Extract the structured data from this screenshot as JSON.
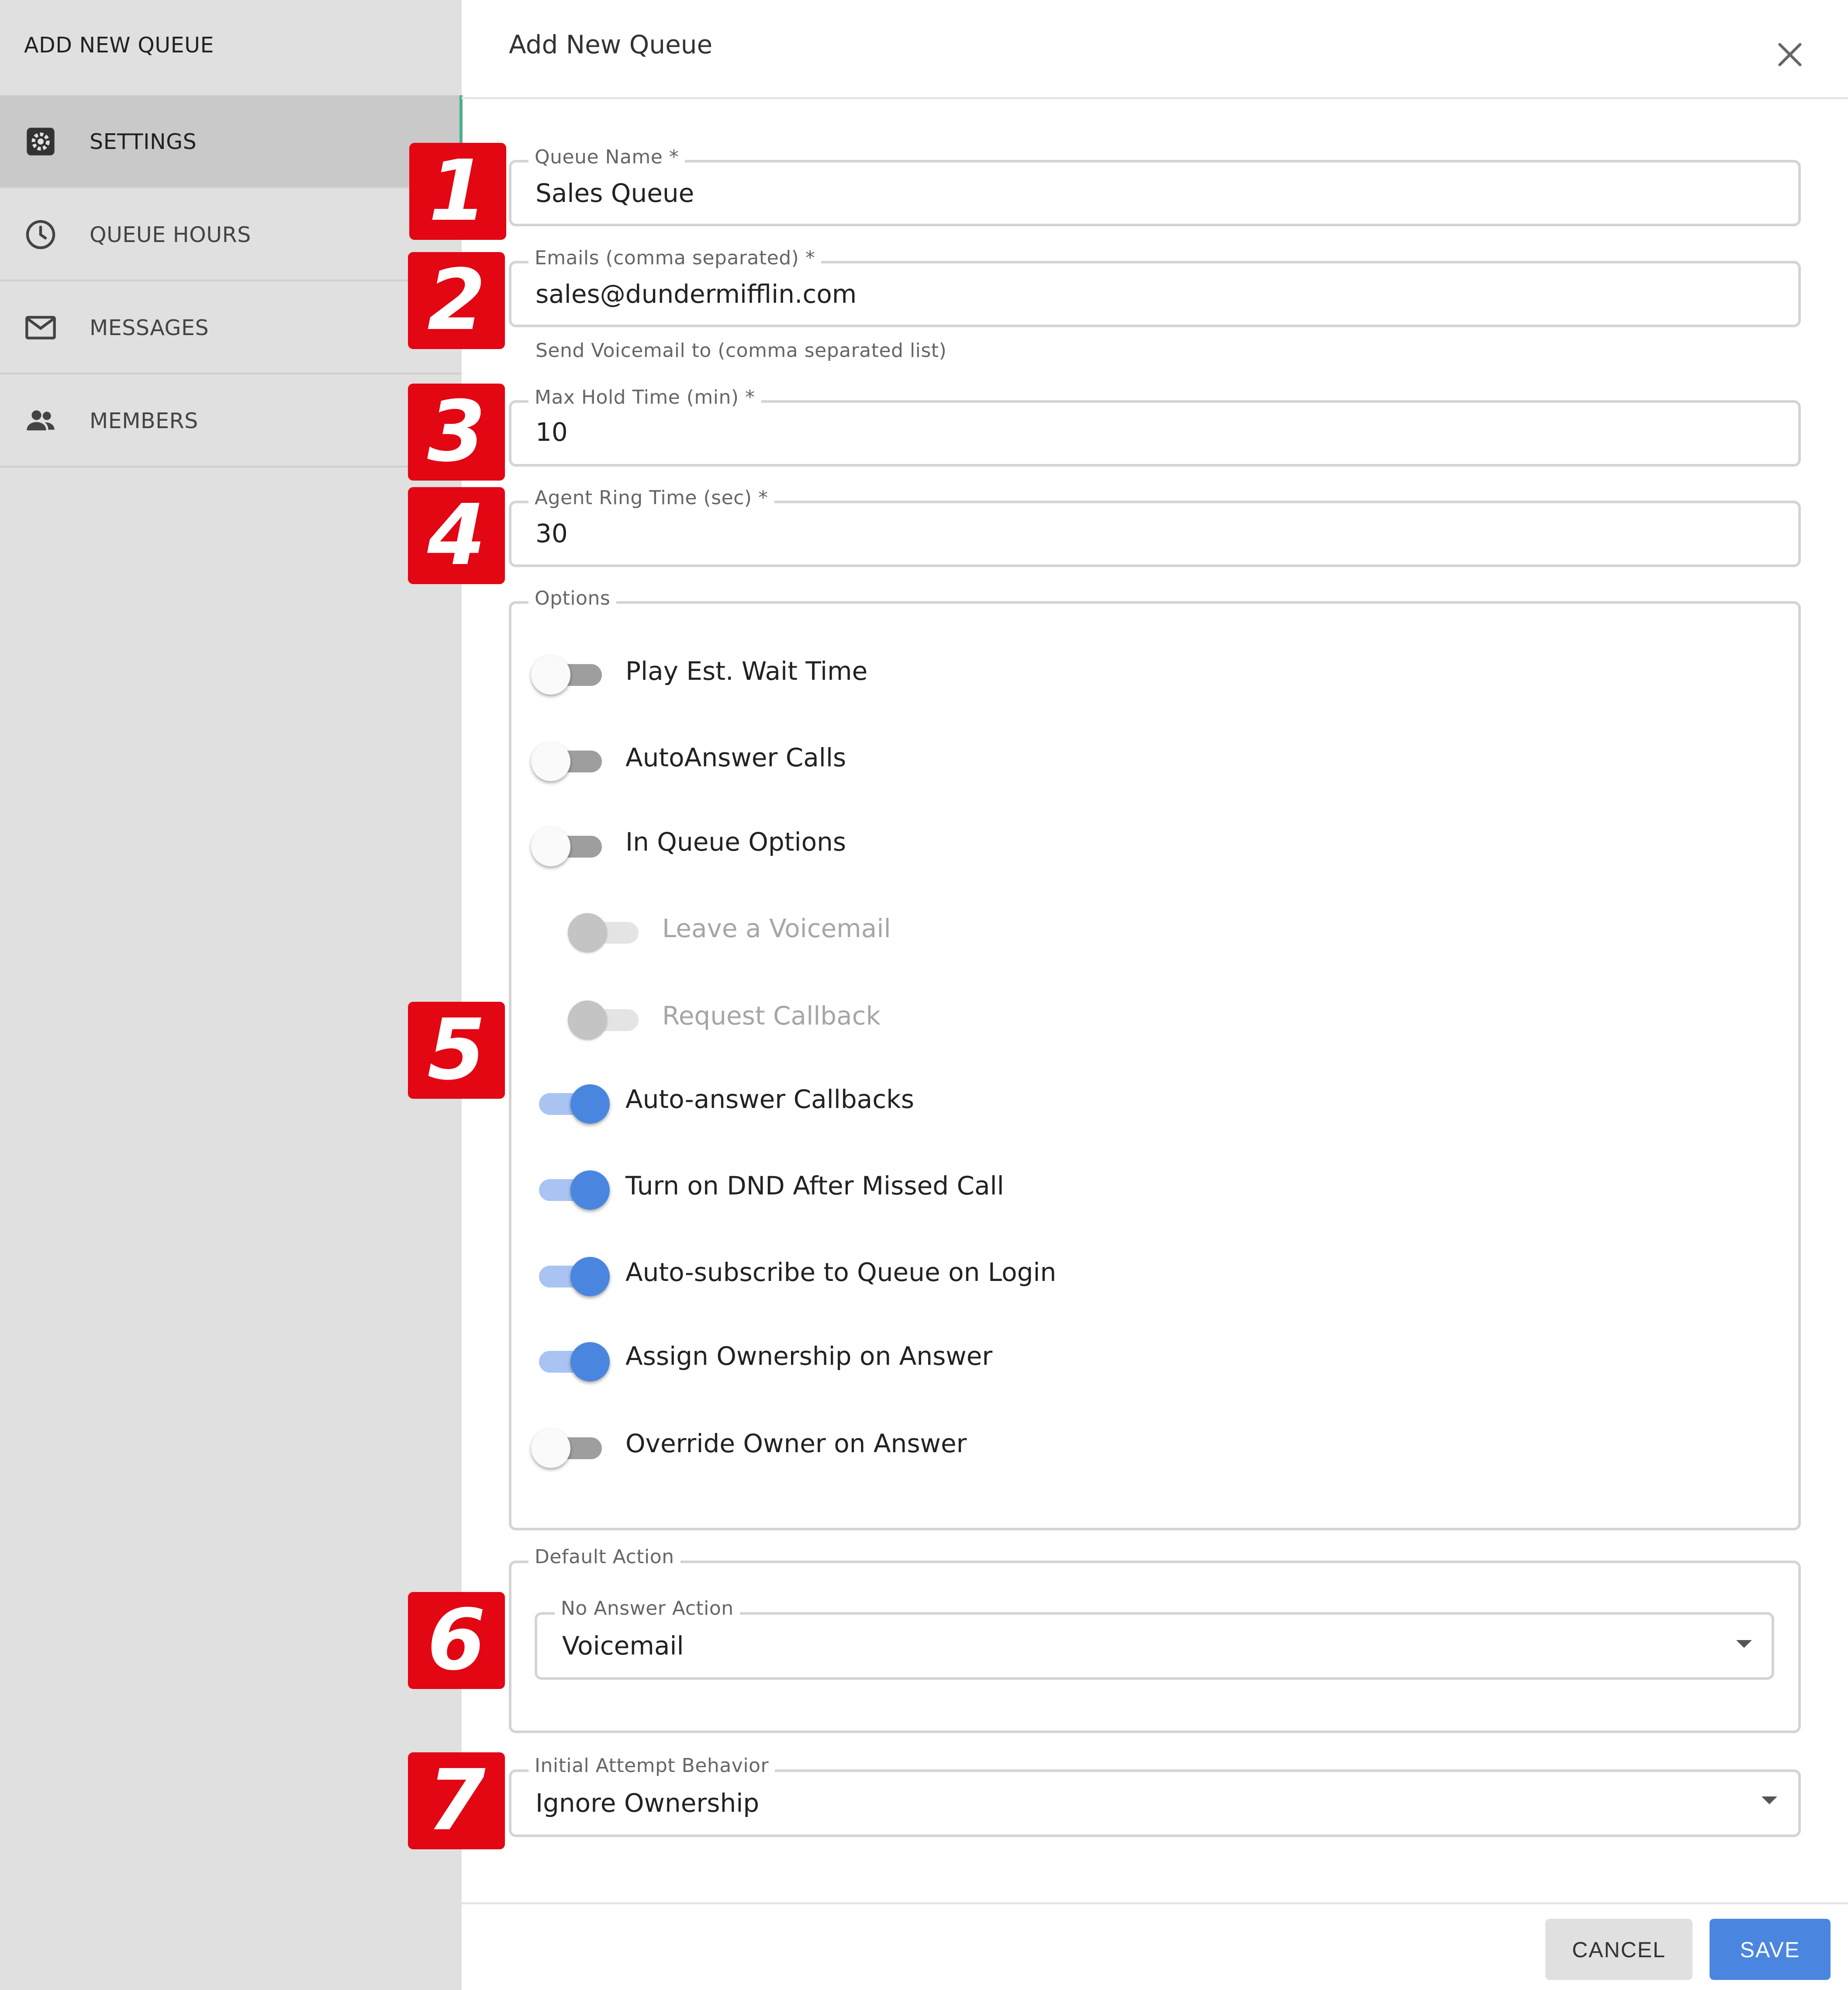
{
  "sidebar": {
    "title": "ADD NEW QUEUE",
    "items": [
      {
        "label": "SETTINGS",
        "icon": "gear-icon",
        "active": true
      },
      {
        "label": "QUEUE HOURS",
        "icon": "clock-icon",
        "active": false
      },
      {
        "label": "MESSAGES",
        "icon": "mail-icon",
        "active": false
      },
      {
        "label": "MEMBERS",
        "icon": "people-icon",
        "active": false
      }
    ]
  },
  "dialog": {
    "title": "Add New Queue",
    "close_icon": "close-icon"
  },
  "form": {
    "queue_name": {
      "label": "Queue Name *",
      "value": "Sales Queue"
    },
    "emails": {
      "label": "Emails (comma separated) *",
      "value": "sales@dundermifflin.com",
      "helper": "Send Voicemail to (comma separated list)"
    },
    "max_hold": {
      "label": "Max Hold Time (min) *",
      "value": "10"
    },
    "agent_ring": {
      "label": "Agent Ring Time (sec) *",
      "value": "30"
    },
    "options": {
      "legend": "Options",
      "items": [
        {
          "label": "Play Est. Wait Time",
          "checked": false,
          "disabled": false
        },
        {
          "label": "AutoAnswer Calls",
          "checked": false,
          "disabled": false
        },
        {
          "label": "In Queue Options",
          "checked": false,
          "disabled": false
        },
        {
          "label": "Leave a Voicemail",
          "checked": false,
          "disabled": true
        },
        {
          "label": "Request Callback",
          "checked": false,
          "disabled": true
        },
        {
          "label": "Auto-answer Callbacks",
          "checked": true,
          "disabled": false
        },
        {
          "label": "Turn on DND After Missed Call",
          "checked": true,
          "disabled": false
        },
        {
          "label": "Auto-subscribe to Queue on Login",
          "checked": true,
          "disabled": false
        },
        {
          "label": "Assign Ownership on Answer",
          "checked": true,
          "disabled": false
        },
        {
          "label": "Override Owner on Answer",
          "checked": false,
          "disabled": false
        }
      ]
    },
    "default_action": {
      "legend": "Default Action",
      "no_answer_label": "No Answer Action",
      "no_answer_value": "Voicemail"
    },
    "initial_attempt": {
      "label": "Initial Attempt Behavior",
      "value": "Ignore Ownership"
    }
  },
  "badges": [
    "1",
    "2",
    "3",
    "4",
    "5",
    "6",
    "7"
  ],
  "footer": {
    "cancel_label": "CANCEL",
    "save_label": "SAVE"
  },
  "colors": {
    "accent": "#4a86e0",
    "badge": "#e30613",
    "sidebar_bg": "#e0e0e0",
    "active_item": "#c9c9c9"
  }
}
